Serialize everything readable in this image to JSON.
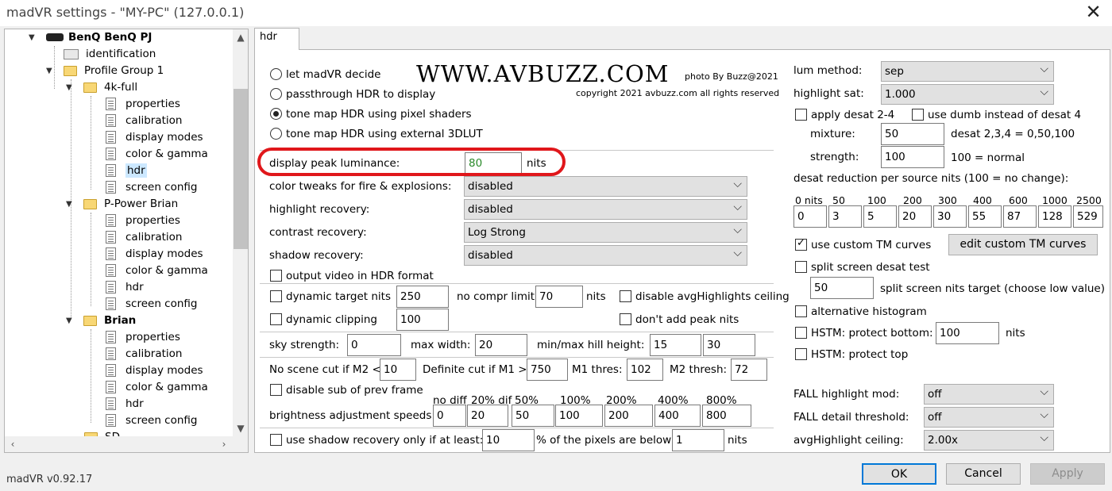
{
  "window": {
    "title": "madVR settings - \"MY-PC\" (127.0.0.1)",
    "close": "✕"
  },
  "tree": {
    "device": "BenQ BenQ PJ",
    "identification": "identification",
    "groups": [
      {
        "name": "Profile Group 1"
      },
      {
        "name": "P-Power Brian"
      },
      {
        "name": "Brian"
      }
    ],
    "profile_4k": "4k-full",
    "items": [
      "properties",
      "calibration",
      "display modes",
      "color & gamma",
      "hdr",
      "screen config"
    ],
    "partial": "SD..."
  },
  "tab": {
    "label": "hdr"
  },
  "watermark": {
    "site": "WWW.AVBUZZ.COM",
    "credit": "photo By Buzz@2021",
    "copyright": "copyright 2021 avbuzz.com all rights reserved"
  },
  "hdr": {
    "radios": [
      {
        "label": "let madVR decide",
        "checked": false
      },
      {
        "label": "passthrough HDR to display",
        "checked": false
      },
      {
        "label": "tone map HDR using pixel shaders",
        "checked": true
      },
      {
        "label": "tone map HDR using external 3DLUT",
        "checked": false
      }
    ],
    "peak_label": "display peak luminance:",
    "peak_value": "80",
    "peak_unit": "nits",
    "fire_label": "color tweaks for fire & explosions:",
    "fire_value": "disabled",
    "hlrec_label": "highlight recovery:",
    "hlrec_value": "disabled",
    "contrast_label": "contrast recovery:",
    "contrast_value": "Log Strong",
    "shadow_label": "shadow recovery:",
    "shadow_value": "disabled",
    "output_hdr": "output video in HDR format",
    "dyn_target": "dynamic target nits",
    "dyn_target_value": "250",
    "no_compr": "no compr limit:",
    "no_compr_value": "70",
    "no_compr_unit": "nits",
    "disable_avg": "disable avgHighlights ceiling",
    "dyn_clip": "dynamic clipping",
    "dyn_clip_value": "100",
    "no_peak": "don't add peak nits",
    "sky_label": "sky strength:",
    "sky_value": "0",
    "maxw_label": "max width:",
    "maxw_value": "20",
    "hill_label": "min/max hill height:",
    "hill_min": "15",
    "hill_max": "30",
    "noscene_label": "No scene cut if M2 <",
    "noscene_value": "10",
    "defcut_label": "Definite cut if M1 >",
    "defcut_value": "750",
    "m1_label": "M1 thres:",
    "m1_value": "102",
    "m2_label": "M2 thresh:",
    "m2_value": "72",
    "disable_sub": "disable sub of prev frame",
    "speed_headers": [
      "no diff",
      "20% dif",
      "50%",
      "100%",
      "200%",
      "400%",
      "800%"
    ],
    "speed_label": "brightness adjustment speeds:",
    "speed_values": [
      "0",
      "20",
      "50",
      "100",
      "200",
      "400",
      "800"
    ],
    "shadow_only": "use shadow recovery only if at least:",
    "shadow_only_value": "10",
    "pixels_below": "% of the pixels are below",
    "pixels_value": "1",
    "pixels_unit": "nits"
  },
  "right": {
    "lum_label": "lum method:",
    "lum_value": "sep",
    "hsat_label": "highlight sat:",
    "hsat_value": "1.000",
    "desat24": "apply desat 2-4",
    "dumb": "use dumb instead of desat 4",
    "mixture_label": "mixture:",
    "mixture_value": "50",
    "mixture_hint": "desat 2,3,4 = 0,50,100",
    "strength_label": "strength:",
    "strength_value": "100",
    "strength_hint": "100 = normal",
    "desat_red_label": "desat reduction per source nits (100 = no change):",
    "nits_headers": [
      "0 nits",
      "50",
      "100",
      "200",
      "300",
      "400",
      "600",
      "1000",
      "2500"
    ],
    "nits_values": [
      "0",
      "3",
      "5",
      "20",
      "30",
      "55",
      "87",
      "128",
      "529"
    ],
    "custom_tm": "use custom TM curves",
    "edit_tm": "edit custom TM curves",
    "split_test": "split screen desat test",
    "split_value": "50",
    "split_hint": "split screen nits target (choose low value)",
    "alt_hist": "alternative histogram",
    "hstm_bottom": "HSTM: protect bottom:",
    "hstm_bottom_value": "100",
    "hstm_unit": "nits",
    "hstm_top": "HSTM: protect top",
    "fall_mod_label": "FALL highlight mod:",
    "fall_mod_value": "off",
    "fall_det_label": "FALL detail threshold:",
    "fall_det_value": "off",
    "avg_ceil_label": "avgHighlight ceiling:",
    "avg_ceil_value": "2.00x"
  },
  "footer": {
    "version": "madVR v0.92.17",
    "ok": "OK",
    "cancel": "Cancel",
    "apply": "Apply"
  }
}
